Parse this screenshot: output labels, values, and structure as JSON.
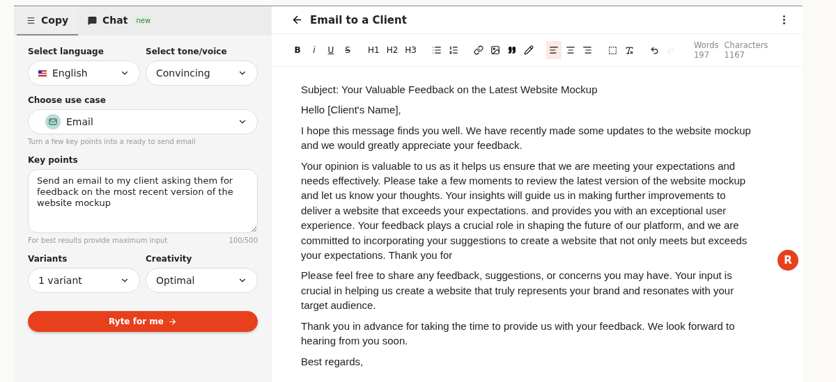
{
  "tabs": [
    {
      "label": "Copy",
      "selected": true
    },
    {
      "label": "Chat",
      "badge": "new",
      "selected": false
    }
  ],
  "form": {
    "language": {
      "label": "Select language",
      "value": "English"
    },
    "tone": {
      "label": "Select tone/voice",
      "value": "Convincing"
    },
    "use_case": {
      "label": "Choose use case",
      "value": "Email",
      "hint": "Turn a few key points into a ready to send email"
    },
    "key_points": {
      "label": "Key points",
      "value": "Send an email to my client asking them for feedback on the most recent version of the website mockup",
      "hint": "For best results provide maximum input",
      "count": "100/500"
    },
    "variants": {
      "label": "Variants",
      "value": "1 variant"
    },
    "creativity": {
      "label": "Creativity",
      "value": "Optimal"
    },
    "submit": "Ryte for me"
  },
  "document": {
    "title": "Email to a Client",
    "toolbar": {
      "format": [
        "B",
        "i",
        "U",
        "S"
      ],
      "headings": [
        "H1",
        "H2",
        "H3"
      ],
      "alignment": [
        {
          "selected": true
        },
        {
          "selected": false
        },
        {
          "selected": false
        }
      ],
      "history": [
        {
          "disabled": false
        },
        {
          "disabled": true
        }
      ]
    },
    "stats": [
      {
        "label": "Words",
        "value": "197"
      },
      {
        "label": "Characters",
        "value": "1167"
      }
    ],
    "paragraphs": [
      "Subject: Your Valuable Feedback on the Latest Website Mockup",
      "Hello [Client's Name],",
      "I hope this message finds you well. We have recently made some updates to the website mockup and we would greatly appreciate your feedback.",
      "Your opinion is valuable to us as it helps us ensure that we are meeting your expectations and needs effectively. Please take a few moments to review the latest version of the website mockup and let us know your thoughts. Your insights will guide us in making further improvements to deliver a website that exceeds your expectations. and provides you with an exceptional user experience. Your feedback plays a crucial role in shaping the future of our platform, and we are committed to incorporating your suggestions to create a website that not only meets but exceeds your expectations. Thank you for",
      "Please feel free to share any feedback, suggestions, or concerns you may have. Your input is crucial in helping us create a website that truly represents your brand and resonates with your target audience.",
      "Thank you in advance for taking the time to provide us with your feedback. We look forward to hearing from you soon.",
      "Best regards,"
    ]
  },
  "avatar": "R"
}
